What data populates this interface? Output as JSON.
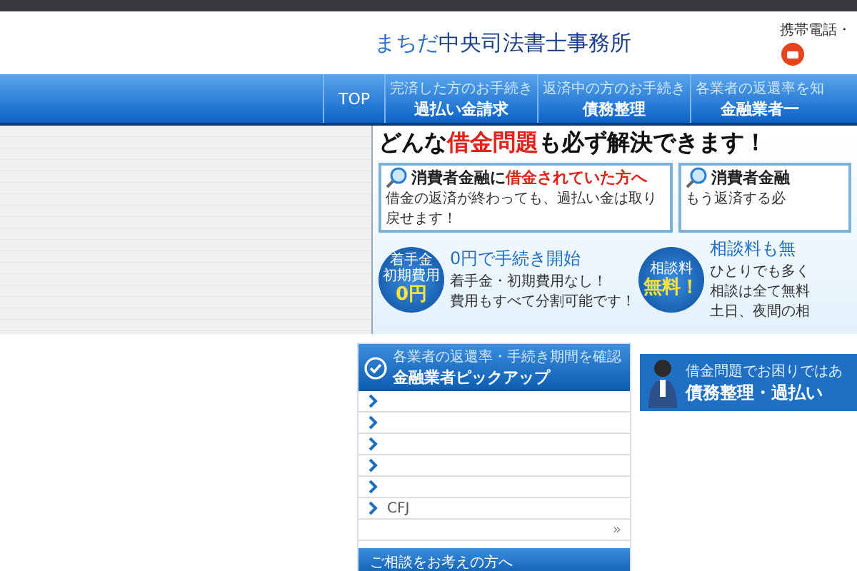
{
  "header": {
    "logo": {
      "prefix": "まちだ",
      "name": "中央司法書士事務所"
    },
    "phone_label": "携帯電話・"
  },
  "nav": [
    {
      "title": "TOP"
    },
    {
      "subtitle": "完済した方のお手続き",
      "title": "過払い金請求"
    },
    {
      "subtitle": "返済中の方のお手続き",
      "title": "債務整理"
    },
    {
      "subtitle": "各業者の返還率を知",
      "title": "金融業者一"
    }
  ],
  "banner": {
    "headline": "どんな**借金問題**も必ず解決できます！",
    "cards": [
      {
        "title": "消費者金融に**借金されていた方へ**",
        "body": "借金の返済が終わっても、過払い金は取り戻せます！"
      },
      {
        "title": "消費者金融",
        "body": "もう返済する必"
      }
    ],
    "offers": [
      {
        "badge": [
          "着手金",
          "初期費用",
          "0円"
        ],
        "title": "0円で手続き開始",
        "lines": [
          "着手金・初期費用なし！",
          "費用もすべて分割可能です！"
        ]
      },
      {
        "badge": [
          "相談料",
          "無料！"
        ],
        "title": "相談料も無",
        "lines": [
          "ひとりでも多く",
          "相談は全て無料",
          "土日、夜間の相"
        ]
      }
    ]
  },
  "sidebar": {
    "subtitle": "各業者の返還率・手続き期間を確認",
    "title": "金融業者ピックアップ",
    "items": [
      {
        "kind": "link"
      },
      {
        "kind": "link"
      },
      {
        "kind": "link"
      },
      {
        "kind": "link"
      },
      {
        "kind": "link"
      },
      {
        "kind": "link",
        "label": "CFJ"
      },
      {
        "kind": "more",
        "label": "»"
      }
    ],
    "next_box": "ご相談をお考えの方へ"
  },
  "promo": {
    "line1": "借金問題でお困りではあ",
    "line2": "債務整理・過払い"
  }
}
